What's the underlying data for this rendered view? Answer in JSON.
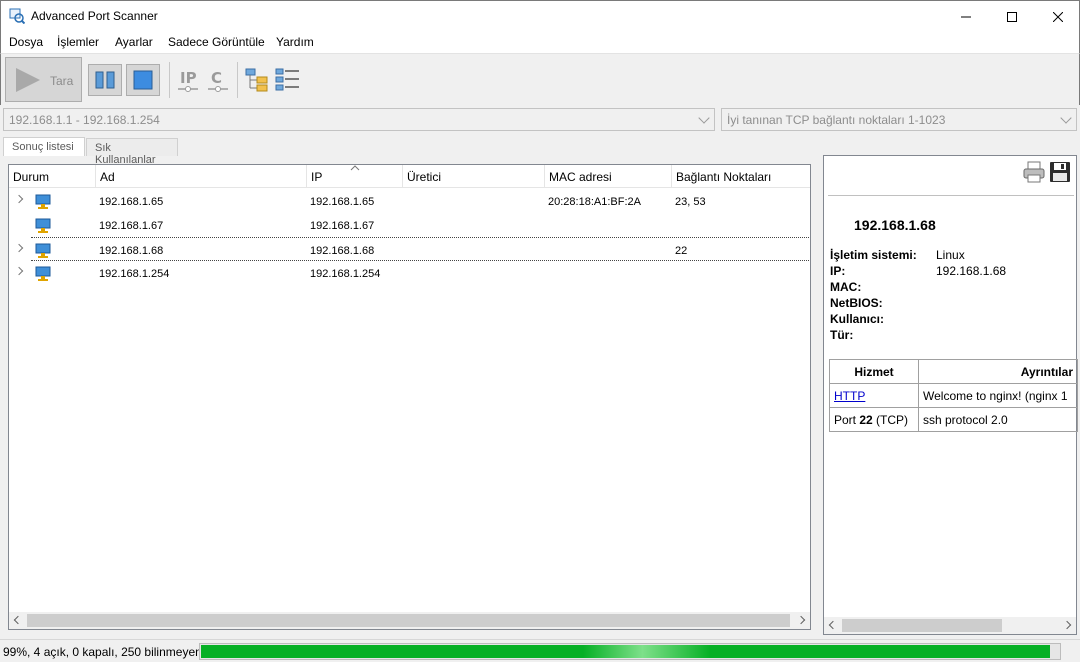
{
  "window": {
    "title": "Advanced Port Scanner"
  },
  "menu": [
    "Dosya",
    "İşlemler",
    "Ayarlar",
    "Sadece Görüntüle",
    "Yardım"
  ],
  "toolbar": {
    "scan_label": "Tara"
  },
  "inputs": {
    "ip_range": "192.168.1.1 - 192.168.1.254",
    "ports": "İyi tanınan TCP bağlantı noktaları 1-1023"
  },
  "tabs": [
    "Sonuç listesi",
    "Sık Kullanılanlar"
  ],
  "table": {
    "columns": [
      "Durum",
      "Ad",
      "IP",
      "Üretici",
      "MAC adresi",
      "Bağlantı Noktaları"
    ],
    "rows": [
      {
        "name": "192.168.1.65",
        "ip": "192.168.1.65",
        "vendor": "",
        "mac": "20:28:18:A1:BF:2A",
        "ports": "23, 53",
        "expandable": true
      },
      {
        "name": "192.168.1.67",
        "ip": "192.168.1.67",
        "vendor": "",
        "mac": "",
        "ports": "",
        "expandable": false
      },
      {
        "name": "192.168.1.68",
        "ip": "192.168.1.68",
        "vendor": "",
        "mac": "",
        "ports": "22",
        "expandable": true
      },
      {
        "name": "192.168.1.254",
        "ip": "192.168.1.254",
        "vendor": "",
        "mac": "",
        "ports": "",
        "expandable": true
      }
    ]
  },
  "details": {
    "host": "192.168.1.68",
    "fields": [
      {
        "key": "İşletim sistemi:",
        "value": "Linux"
      },
      {
        "key": "IP:",
        "value": "192.168.1.68"
      },
      {
        "key": "MAC:",
        "value": ""
      },
      {
        "key": "NetBIOS:",
        "value": ""
      },
      {
        "key": "Kullanıcı:",
        "value": ""
      },
      {
        "key": "Tür:",
        "value": ""
      }
    ],
    "services": {
      "headers": [
        "Hizmet",
        "Ayrıntılar"
      ],
      "rows": [
        {
          "service": "HTTP",
          "detail": "Welcome to nginx! (nginx 1"
        },
        {
          "service_prefix": "Port ",
          "service_port": "22",
          "service_suffix": " (TCP)",
          "detail": "ssh protocol 2.0"
        }
      ]
    }
  },
  "status": {
    "text": "99%, 4 açık, 0 kapalı, 250 bilinmeyen",
    "progress": 0.99
  },
  "colors": {
    "progress_fill": "#06b025",
    "link": "#0000cc"
  }
}
